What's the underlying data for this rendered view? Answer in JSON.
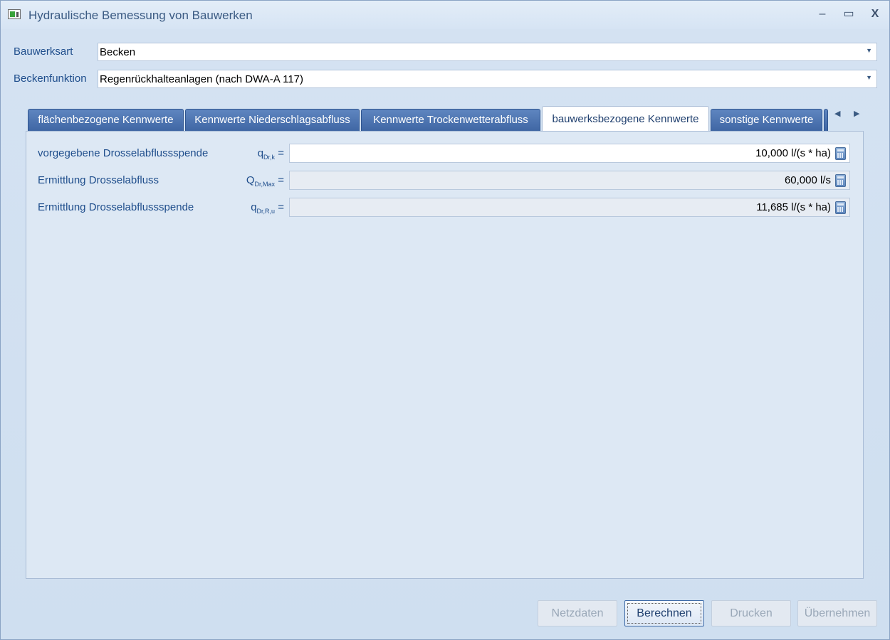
{
  "window": {
    "title": "Hydraulische Bemessung von Bauwerken",
    "minimize": "–",
    "maximize": "▭",
    "close": "X"
  },
  "fields": {
    "bauwerksart": {
      "label": "Bauwerksart",
      "value": "Becken"
    },
    "beckenfunktion": {
      "label": "Beckenfunktion",
      "value": "Regenrückhalteanlagen (nach DWA-A 117)"
    }
  },
  "tabs": [
    {
      "label": "flächenbezogene Kennwerte",
      "active": false
    },
    {
      "label": "Kennwerte Niederschlagsabfluss",
      "active": false
    },
    {
      "label": "Kennwerte Trockenwetterabfluss",
      "active": false
    },
    {
      "label": "bauwerksbezogene Kennwerte",
      "active": true
    },
    {
      "label": "sonstige Kennwerte",
      "active": false
    }
  ],
  "rows": [
    {
      "label": "vorgegebene Drosselabflussspende",
      "symbol": "q",
      "sub": "Dr,k",
      "eq": " =",
      "value": "10,000 l/(s * ha)",
      "editable": true
    },
    {
      "label": "Ermittlung Drosselabfluss",
      "symbol": "Q",
      "sub": "Dr,Max",
      "eq": " =",
      "value": "60,000 l/s",
      "editable": false
    },
    {
      "label": "Ermittlung Drosselabflussspende",
      "symbol": "q",
      "sub": "Dr,R,u",
      "eq": " =",
      "value": "11,685 l/(s * ha)",
      "editable": false
    }
  ],
  "buttons": {
    "netzdaten": "Netzdaten",
    "berechnen": "Berechnen",
    "drucken": "Drucken",
    "uebernehmen": "Übernehmen"
  }
}
